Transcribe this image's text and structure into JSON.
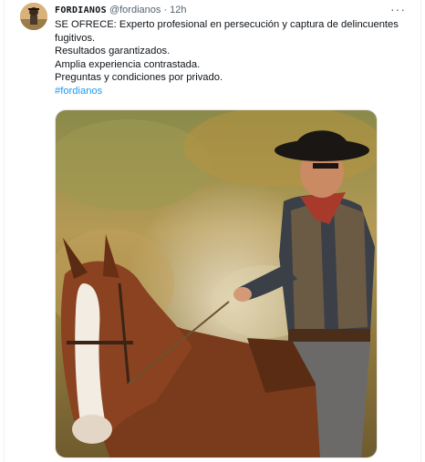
{
  "tweet": {
    "author_name": "FORDIANOS",
    "author_handle": "@fordianos",
    "separator": "·",
    "time": "12h",
    "more_label": "···",
    "lines": [
      "SE OFRECE: Experto profesional en persecución y captura de delincuentes fugitivos.",
      "Resultados garantizados.",
      "Amplia experiencia contrastada.",
      "Preguntas y condiciones por privado."
    ],
    "hashtag": "#fordianos"
  },
  "colors": {
    "text": "#0f1419",
    "secondary": "#536471",
    "link": "#1d9bf0"
  },
  "icons": {
    "more": "more-icon"
  }
}
